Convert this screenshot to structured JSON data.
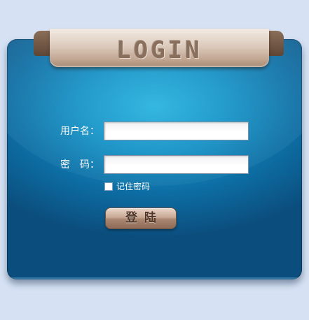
{
  "header": {
    "title": "LOGIN"
  },
  "form": {
    "username_label": "用户名：",
    "username_value": "",
    "password_label": "密　码：",
    "password_value": "",
    "remember_label": "记住密码",
    "remember_checked": false,
    "submit_label": "登陆"
  },
  "colors": {
    "background": "#d6e2f4",
    "panel_accent": "#1592c6",
    "ribbon": "#c1a692"
  }
}
